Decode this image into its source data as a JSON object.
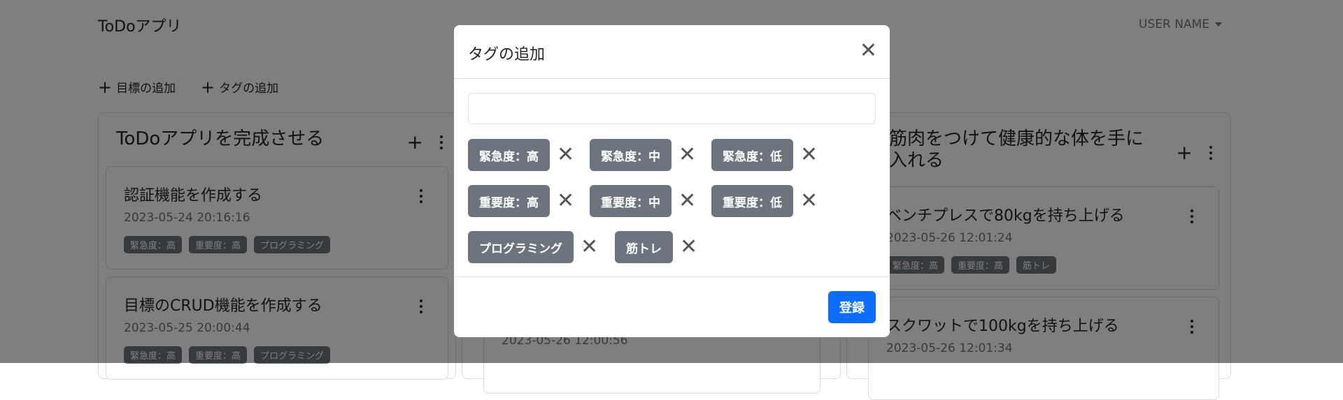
{
  "navbar": {
    "brand": "ToDoアプリ",
    "user_name": "USER NAME"
  },
  "actions": {
    "add_goal": "目標の追加",
    "add_tag": "タグの追加"
  },
  "columns": [
    {
      "title": "ToDoアプリを完成させる",
      "cards": [
        {
          "title": "認証機能を作成する",
          "date": "2023-05-24 20:16:16",
          "tags": [
            "緊急度：高",
            "重要度：高",
            "プログラミング"
          ]
        },
        {
          "title": "目標のCRUD機能を作成する",
          "date": "2023-05-25 20:00:44",
          "tags": [
            "緊急度：高",
            "重要度：高",
            "プログラミング"
          ]
        }
      ]
    },
    {
      "cards": [
        {
          "date": "2023-05-26 12:00:56"
        }
      ]
    },
    {
      "title": "筋肉をつけて健康的な体を手に入れる",
      "cards": [
        {
          "title": "ベンチプレスで80kgを持ち上げる",
          "date": "2023-05-26 12:01:24",
          "tags": [
            "緊急度：高",
            "重要度：高",
            "筋トレ"
          ]
        },
        {
          "title": "スクワットで100kgを持ち上げる",
          "date": "2023-05-26 12:01:34"
        }
      ]
    }
  ],
  "modal": {
    "title": "タグの追加",
    "input_value": "",
    "tags": [
      [
        "緊急度：高",
        "緊急度：中",
        "緊急度：低"
      ],
      [
        "重要度：高",
        "重要度：中",
        "重要度：低"
      ],
      [
        "プログラミング",
        "筋トレ"
      ]
    ],
    "submit_label": "登録"
  },
  "colors": {
    "primary": "#0d6efd",
    "tag_gray": "#6c757d",
    "overlay": "rgba(0,0,0,0.5)"
  }
}
